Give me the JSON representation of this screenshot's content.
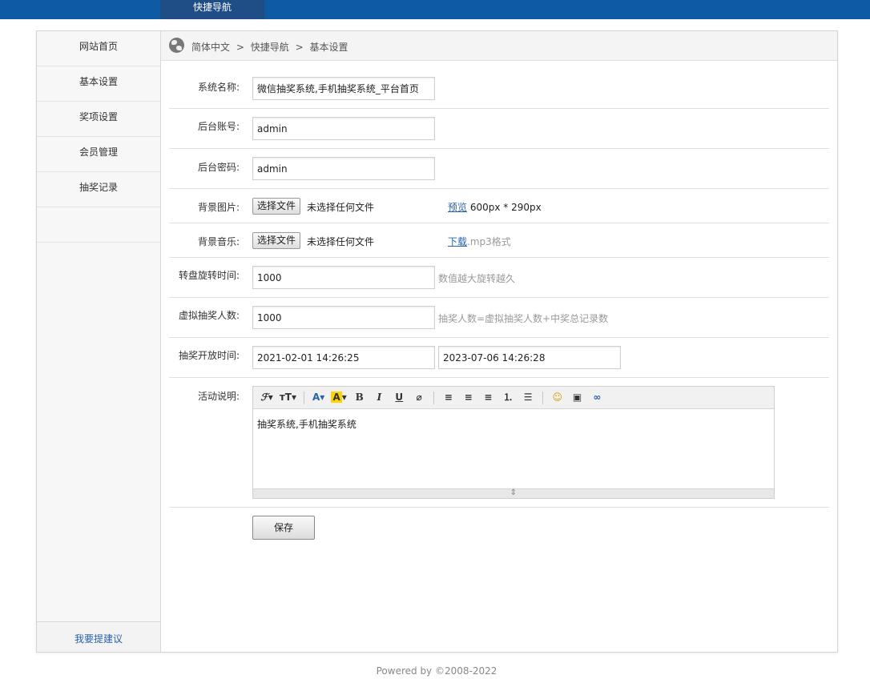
{
  "topnav": {
    "active_tab": "快捷导航"
  },
  "sidebar": {
    "items": [
      {
        "label": "网站首页"
      },
      {
        "label": "基本设置"
      },
      {
        "label": "奖项设置"
      },
      {
        "label": "会员管理"
      },
      {
        "label": "抽奖记录"
      },
      {
        "label": ""
      }
    ],
    "footer_link": "我要提建议"
  },
  "breadcrumb": {
    "items": [
      "简体中文",
      ">",
      "快捷导航",
      ">",
      "基本设置"
    ]
  },
  "form": {
    "system_name": {
      "label": "系统名称:",
      "value": "微信抽奖系统,手机抽奖系统_平台首页"
    },
    "admin_account": {
      "label": "后台账号:",
      "value": "admin"
    },
    "admin_password": {
      "label": "后台密码:",
      "value": "admin"
    },
    "bg_image": {
      "label": "背景图片:",
      "button": "选择文件",
      "status": "未选择任何文件",
      "link": "预览",
      "note": "600px * 290px"
    },
    "bg_music": {
      "label": "背景音乐:",
      "button": "选择文件",
      "status": "未选择任何文件",
      "link": "下载",
      "note": ".mp3格式"
    },
    "spin_time": {
      "label": "转盘旋转时间:",
      "value": "1000",
      "hint": "数值越大旋转越久"
    },
    "virtual_count": {
      "label": "虚拟抽奖人数:",
      "value": "1000",
      "hint": "抽奖人数=虚拟抽奖人数+中奖总记录数"
    },
    "open_time": {
      "label": "抽奖开放时间:",
      "start": "2021-02-01 14:26:25",
      "end": "2023-07-06 14:26:28"
    },
    "description": {
      "label": "活动说明:",
      "content": "抽奖系统,手机抽奖系统"
    },
    "save_label": "保存"
  },
  "editor_toolbar": {
    "font_family": "ℱ▾",
    "font_size": "тT▾",
    "font_color": "A▾",
    "bg_color": "A",
    "bg_caret": "▾",
    "bold": "B",
    "italic": "I",
    "underline": "U",
    "eraser": "⌀",
    "align_left": "≡",
    "align_center": "≡",
    "align_right": "≡",
    "ordered_list": "⒈",
    "unordered_list": "☰",
    "emoticon": "☺",
    "image": "▣",
    "link": "∞",
    "resize_handle": "⇕"
  },
  "footer": {
    "text": "Powered by ©2008-2022"
  },
  "colors": {
    "topbar": "#0e5aa3",
    "active_tab": "#1f4e86",
    "link": "#2a62a8"
  }
}
